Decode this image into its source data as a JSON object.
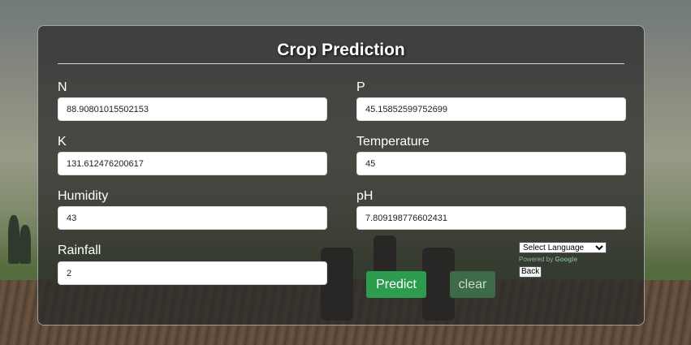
{
  "page": {
    "title": "Crop Prediction"
  },
  "fields": {
    "n": {
      "label": "N",
      "value": "88.90801015502153"
    },
    "p": {
      "label": "P",
      "value": "45.15852599752699"
    },
    "k": {
      "label": "K",
      "value": "131.612476200617"
    },
    "temperature": {
      "label": "Temperature",
      "value": "45"
    },
    "humidity": {
      "label": "Humidity",
      "value": "43"
    },
    "ph": {
      "label": "pH",
      "value": "7.809198776602431"
    },
    "rainfall": {
      "label": "Rainfall",
      "value": "2"
    }
  },
  "actions": {
    "predict_label": "Predict",
    "clear_label": "clear",
    "back_label": "Back"
  },
  "translate": {
    "select_label": "Select Language",
    "powered_by": "Powered by",
    "brand": "Google"
  },
  "colors": {
    "predict_button": "#2e9c4f",
    "clear_button": "#3d6b47",
    "panel": "rgba(40,40,40,0.72)"
  }
}
